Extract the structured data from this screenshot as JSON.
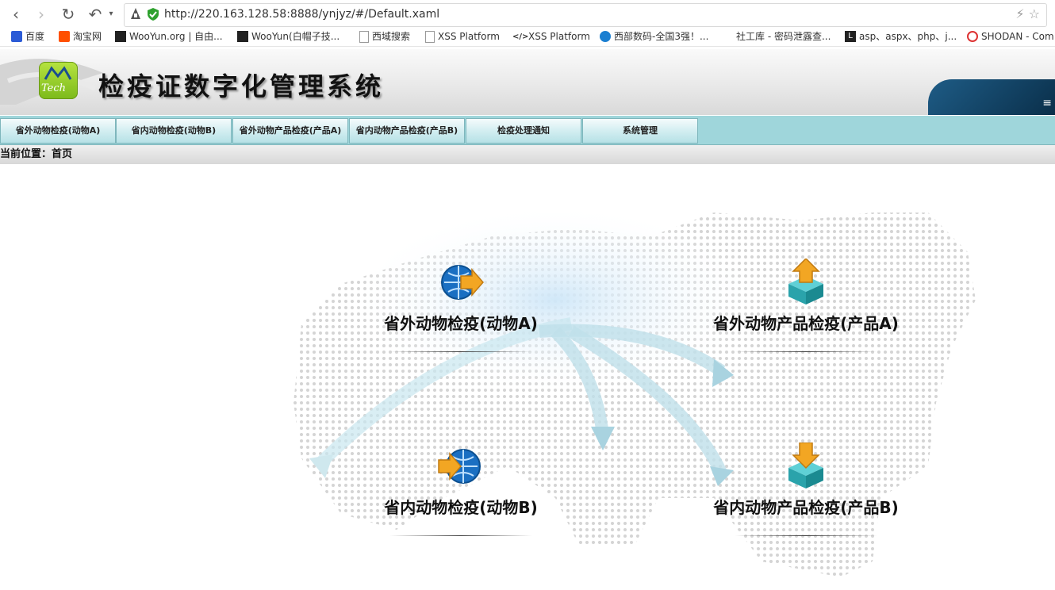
{
  "browser": {
    "url": "http://220.163.128.58:8888/ynjyz/#/Default.xaml",
    "bookmarks": [
      {
        "label": "百度",
        "icon": "paw-icon"
      },
      {
        "label": "淘宝网",
        "icon": "taobao-icon"
      },
      {
        "label": "WooYun.org | 自由...",
        "icon": "wooyun-icon"
      },
      {
        "label": "WooYun(白帽子技...",
        "icon": "wooyun-icon"
      },
      {
        "label": "西域搜索",
        "icon": "page-icon"
      },
      {
        "label": "XSS Platform",
        "icon": "page-icon"
      },
      {
        "label": "XSS Platform",
        "icon": "code-icon"
      },
      {
        "label": "西部数码-全国3强！...",
        "icon": "westcn-icon"
      },
      {
        "label": "社工库 - 密码泄露查...",
        "icon": ""
      },
      {
        "label": "asp、aspx、php、j...",
        "icon": "l-icon"
      },
      {
        "label": "SHODAN - Com",
        "icon": "shodan-icon"
      }
    ]
  },
  "header": {
    "logo_text": "Tech",
    "title": "检疫证数字化管理系统"
  },
  "nav": {
    "tabs": [
      "省外动物检疫(动物A)",
      "省内动物检疫(动物B)",
      "省外动物产品检疫(产品A)",
      "省内动物产品检疫(产品B)",
      "检疫处理通知",
      "系统管理"
    ]
  },
  "breadcrumb": "当前位置：首页",
  "tiles": [
    {
      "label": "省外动物检疫(动物A)",
      "icon": "globe-arrow-out-icon"
    },
    {
      "label": "省外动物产品检疫(产品A)",
      "icon": "box-upload-icon"
    },
    {
      "label": "省内动物检疫(动物B)",
      "icon": "globe-arrow-in-icon"
    },
    {
      "label": "省内动物产品检疫(产品B)",
      "icon": "box-download-icon"
    }
  ],
  "colors": {
    "nav_bg": "#9fd6db",
    "logo_green": "#7cba1b"
  }
}
